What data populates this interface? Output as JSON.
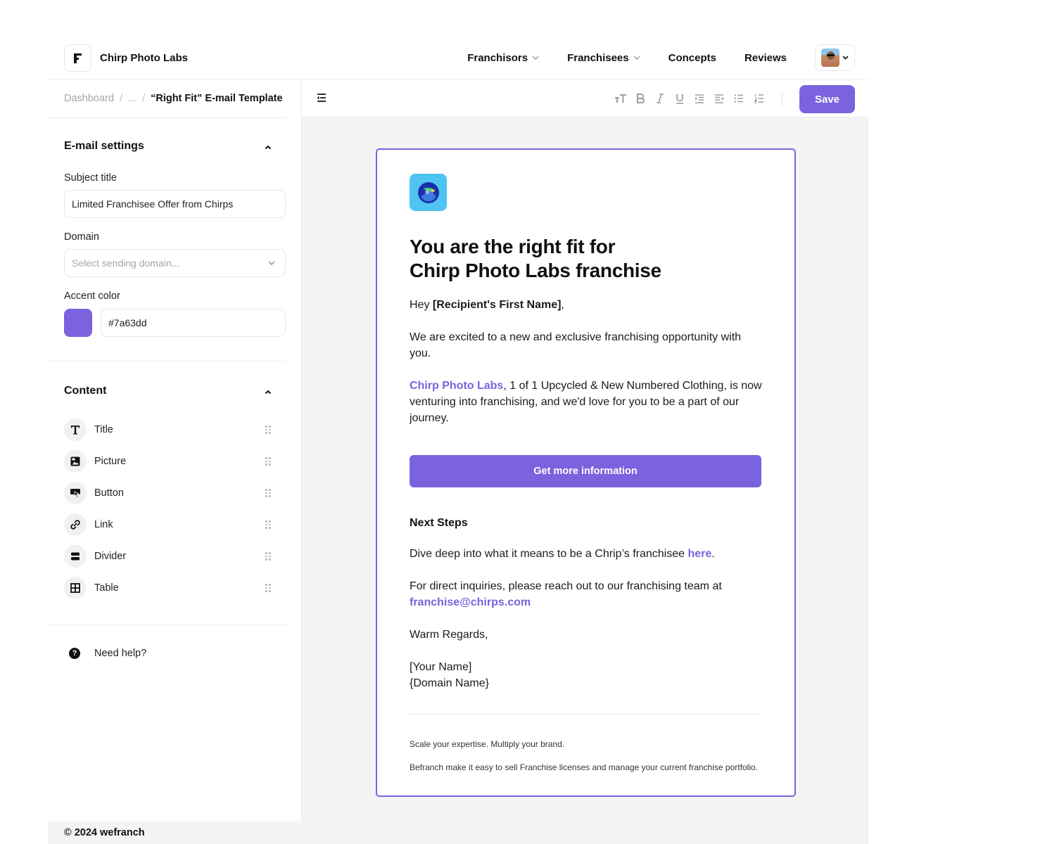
{
  "header": {
    "app_name": "Chirp Photo Labs",
    "logo_icon": "brand-f-icon",
    "nav": [
      {
        "label": "Franchisors",
        "has_dropdown": true
      },
      {
        "label": "Franchisees",
        "has_dropdown": true
      },
      {
        "label": "Concepts",
        "has_dropdown": false
      },
      {
        "label": "Reviews",
        "has_dropdown": false
      }
    ],
    "avatar_chevron": "⌄"
  },
  "breadcrumb": {
    "items": [
      "Dashboard",
      "...",
      "“Right Fit” E-mail Template"
    ],
    "separator": "/"
  },
  "email_settings": {
    "title": "E-mail settings",
    "toggle": "⌃",
    "subject_label": "Subject title",
    "subject_value": "Limited Franchisee Offer from Chirps",
    "domain_label": "Domain",
    "domain_placeholder": "Select sending domain...",
    "accent_label": "Accent color",
    "accent_value": "#7a63dd"
  },
  "content_panel": {
    "title": "Content",
    "toggle": "⌃",
    "items": [
      {
        "label": "Title",
        "icon": "text-icon"
      },
      {
        "label": "Picture",
        "icon": "picture-icon"
      },
      {
        "label": "Button",
        "icon": "button-icon"
      },
      {
        "label": "Link",
        "icon": "link-icon"
      },
      {
        "label": "Divider",
        "icon": "divider-icon"
      },
      {
        "label": "Table",
        "icon": "table-icon"
      }
    ]
  },
  "help": {
    "label": "Need help?",
    "icon_glyph": "?"
  },
  "toolbar": {
    "buttons": [
      {
        "name": "text-size",
        "glyph": "тT"
      },
      {
        "name": "bold",
        "glyph": "B"
      },
      {
        "name": "italic",
        "glyph": "I"
      },
      {
        "name": "underline",
        "glyph": "U"
      },
      {
        "name": "indent",
        "glyph": "⇥"
      },
      {
        "name": "outdent",
        "glyph": "⇤"
      },
      {
        "name": "bullet-list",
        "glyph": "≔"
      },
      {
        "name": "numbered-list",
        "glyph": "≡"
      }
    ],
    "save_label": "Save"
  },
  "email": {
    "headline_line1": "You are the right fit for",
    "headline_line2": "Chirp Photo Labs franchise",
    "greeting_prefix": "Hey ",
    "greeting_name": "[Recipient's First Name]",
    "greeting_suffix": ",",
    "intro": "We are excited to a new and exclusive franchising opportunity with you.",
    "brand_link": "Chirp Photo Labs",
    "body": ", 1 of 1 Upcycled & New Numbered Clothing, is now venturing into franchising, and we'd love for you to be a part of our journey.",
    "cta_label": "Get more information",
    "next_steps_title": "Next Steps",
    "dive_text": "Dive deep into what it means to be a Chrip’s franchisee ",
    "dive_link": "here",
    "dive_suffix": ".",
    "inquiry_text": "For direct inquiries, please reach out to our franchising team at",
    "inquiry_email": "franchise@chirps.com",
    "regards": "Warm Regards,",
    "your_name": "[Your Name]",
    "domain_name": "{Domain Name}",
    "footer_tagline": "Scale your expertise. Multiply your brand.",
    "footer_desc": "Befranch make it easy to sell Franchise licenses and manage your current franchise portfolio."
  },
  "footer": {
    "copyright": "© 2024 wefranch"
  },
  "colors": {
    "accent": "#7a63dd",
    "canvas": "#f4f4f4",
    "brand_icon_bg": "#4fc3f2"
  }
}
